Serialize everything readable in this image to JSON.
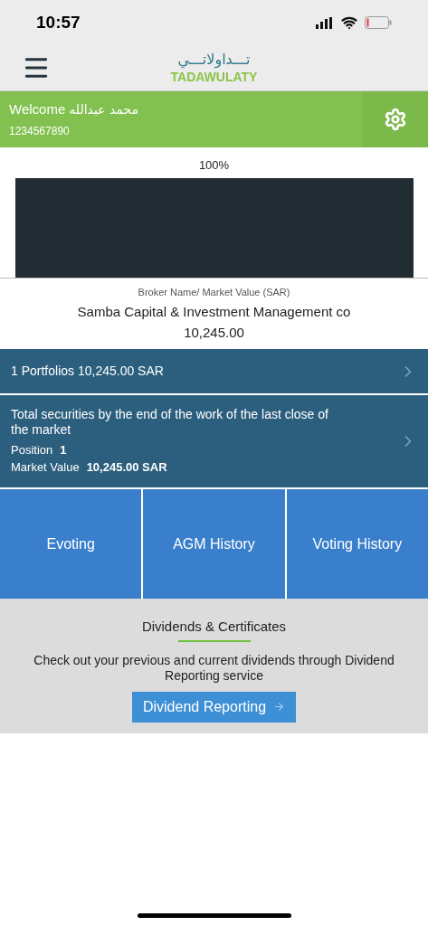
{
  "status_bar": {
    "time": "10:57"
  },
  "header": {
    "logo_arabic": "تـــداولاتـــي",
    "logo_latin": "TADAWULATY"
  },
  "welcome": {
    "greeting": "Welcome",
    "name": "محمد عبدالله",
    "account": "1234567890"
  },
  "allocation": {
    "label": "100%"
  },
  "broker": {
    "caption": "Broker Name/ Market Value (SAR)",
    "name": "Samba Capital & Investment Management co",
    "value": "10,245.00"
  },
  "portfolios": {
    "text": "1 Portfolios 10,245.00 SAR"
  },
  "securities": {
    "title": "Total securities by the end of the work of the last close of the market",
    "rows": [
      {
        "label": "Position",
        "value": "1"
      },
      {
        "label": "Market Value",
        "value": "10,245.00 SAR"
      }
    ]
  },
  "tiles": [
    "Evoting",
    "AGM History",
    "Voting History"
  ],
  "dividends": {
    "title": "Dividends & Certificates",
    "description": "Check out your previous and current dividends through Dividend Reporting service",
    "button": "Dividend Reporting"
  }
}
